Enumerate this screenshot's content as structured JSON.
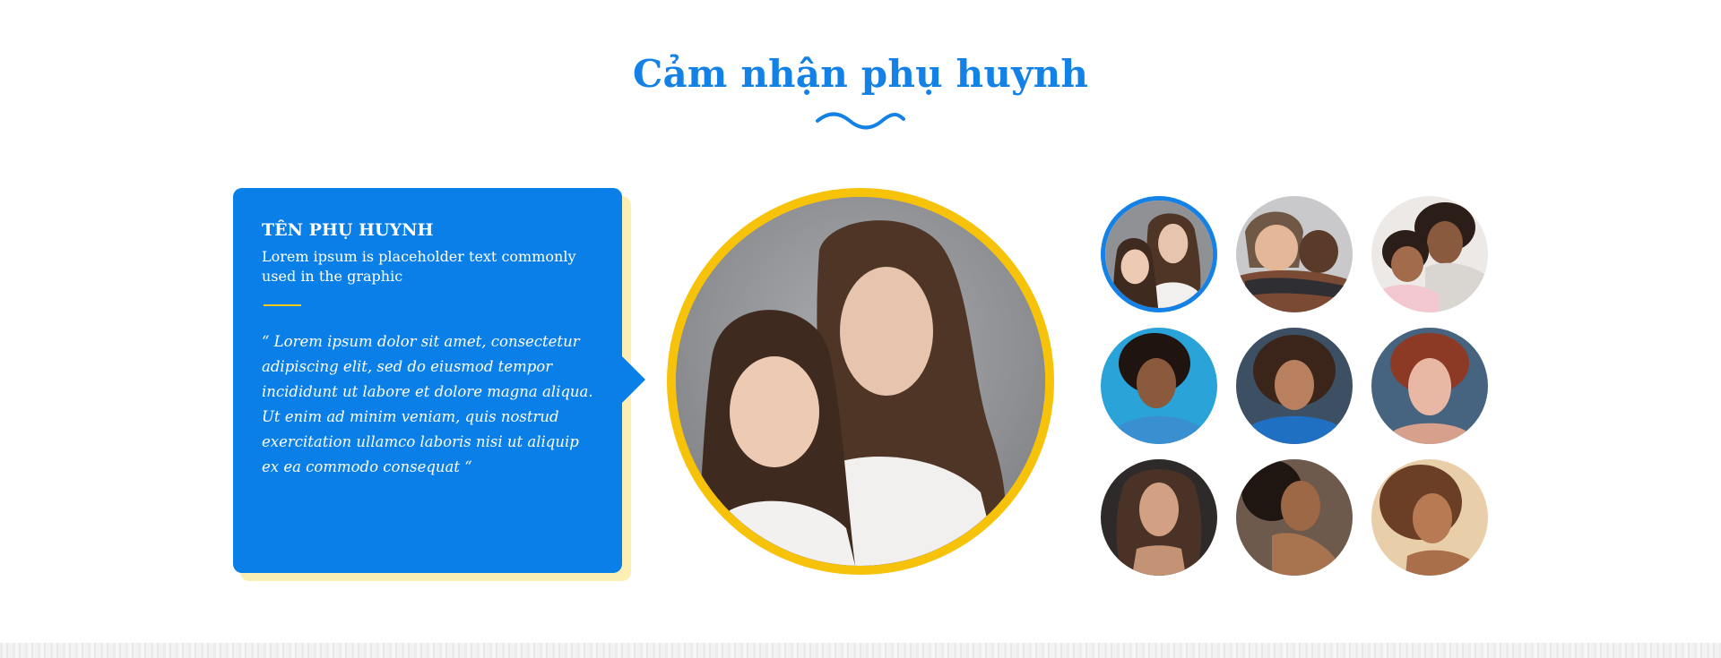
{
  "section": {
    "title": "Cảm nhận phụ huynh"
  },
  "testimonial": {
    "parent_name": "TÊN PHỤ HUYNH",
    "subtitle": "Lorem ipsum is placeholder text commonly used in the graphic",
    "quote": "“ Lorem ipsum dolor sit amet, consectetur adipiscing elit, sed do eiusmod tempor incididunt ut labore et dolore magna aliqua. Ut enim ad minim veniam, quis nostrud exercitation ullamco laboris nisi ut aliquip ex ea commodo consequat “"
  },
  "main_photo": {
    "subject": "mother-and-daughter-portrait"
  },
  "thumbnails": [
    {
      "subject": "mother-and-daughter-portrait",
      "active": true
    },
    {
      "subject": "woman-hugging-child",
      "active": false
    },
    {
      "subject": "mother-and-daughter-hug",
      "active": false
    },
    {
      "subject": "smiling-woman-blue-background",
      "active": false
    },
    {
      "subject": "curly-hair-woman-blue-sweater",
      "active": false
    },
    {
      "subject": "red-haired-woman-portrait",
      "active": false
    },
    {
      "subject": "woman-dark-portrait",
      "active": false
    },
    {
      "subject": "woman-profile-eyes-closed",
      "active": false
    },
    {
      "subject": "curly-hair-woman-smiling",
      "active": false
    }
  ],
  "colors": {
    "accent_blue": "#1481e6",
    "card_blue": "#0a7fe8",
    "accent_yellow": "#f7c20a",
    "card_shadow": "#fcefb4"
  }
}
